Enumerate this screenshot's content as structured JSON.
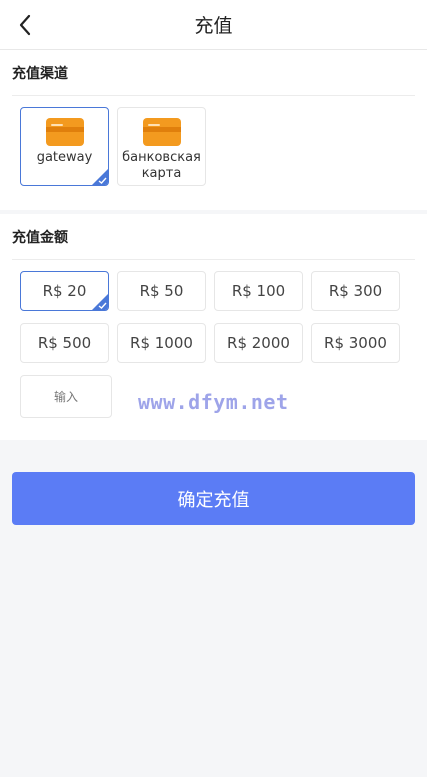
{
  "header": {
    "title": "充值",
    "back_icon": "chevron-left-icon"
  },
  "channel_section": {
    "title": "充值渠道",
    "items": [
      {
        "label": "gateway",
        "selected": true,
        "icon": "card-icon"
      },
      {
        "label": "банковская карта",
        "selected": false,
        "icon": "card-icon"
      }
    ]
  },
  "amount_section": {
    "title": "充值金额",
    "options": [
      {
        "label": "R$ 20",
        "selected": true
      },
      {
        "label": "R$ 50",
        "selected": false
      },
      {
        "label": "R$ 100",
        "selected": false
      },
      {
        "label": "R$ 300",
        "selected": false
      },
      {
        "label": "R$ 500",
        "selected": false
      },
      {
        "label": "R$ 1000",
        "selected": false
      },
      {
        "label": "R$ 2000",
        "selected": false
      },
      {
        "label": "R$ 3000",
        "selected": false
      }
    ],
    "input_placeholder": "输入",
    "input_value": ""
  },
  "watermark": "www.dfym.net",
  "confirm_label": "确定充值",
  "colors": {
    "accent": "#5b7cf5",
    "selected_border": "#4a78d8",
    "icon_orange": "#f39a1f"
  }
}
